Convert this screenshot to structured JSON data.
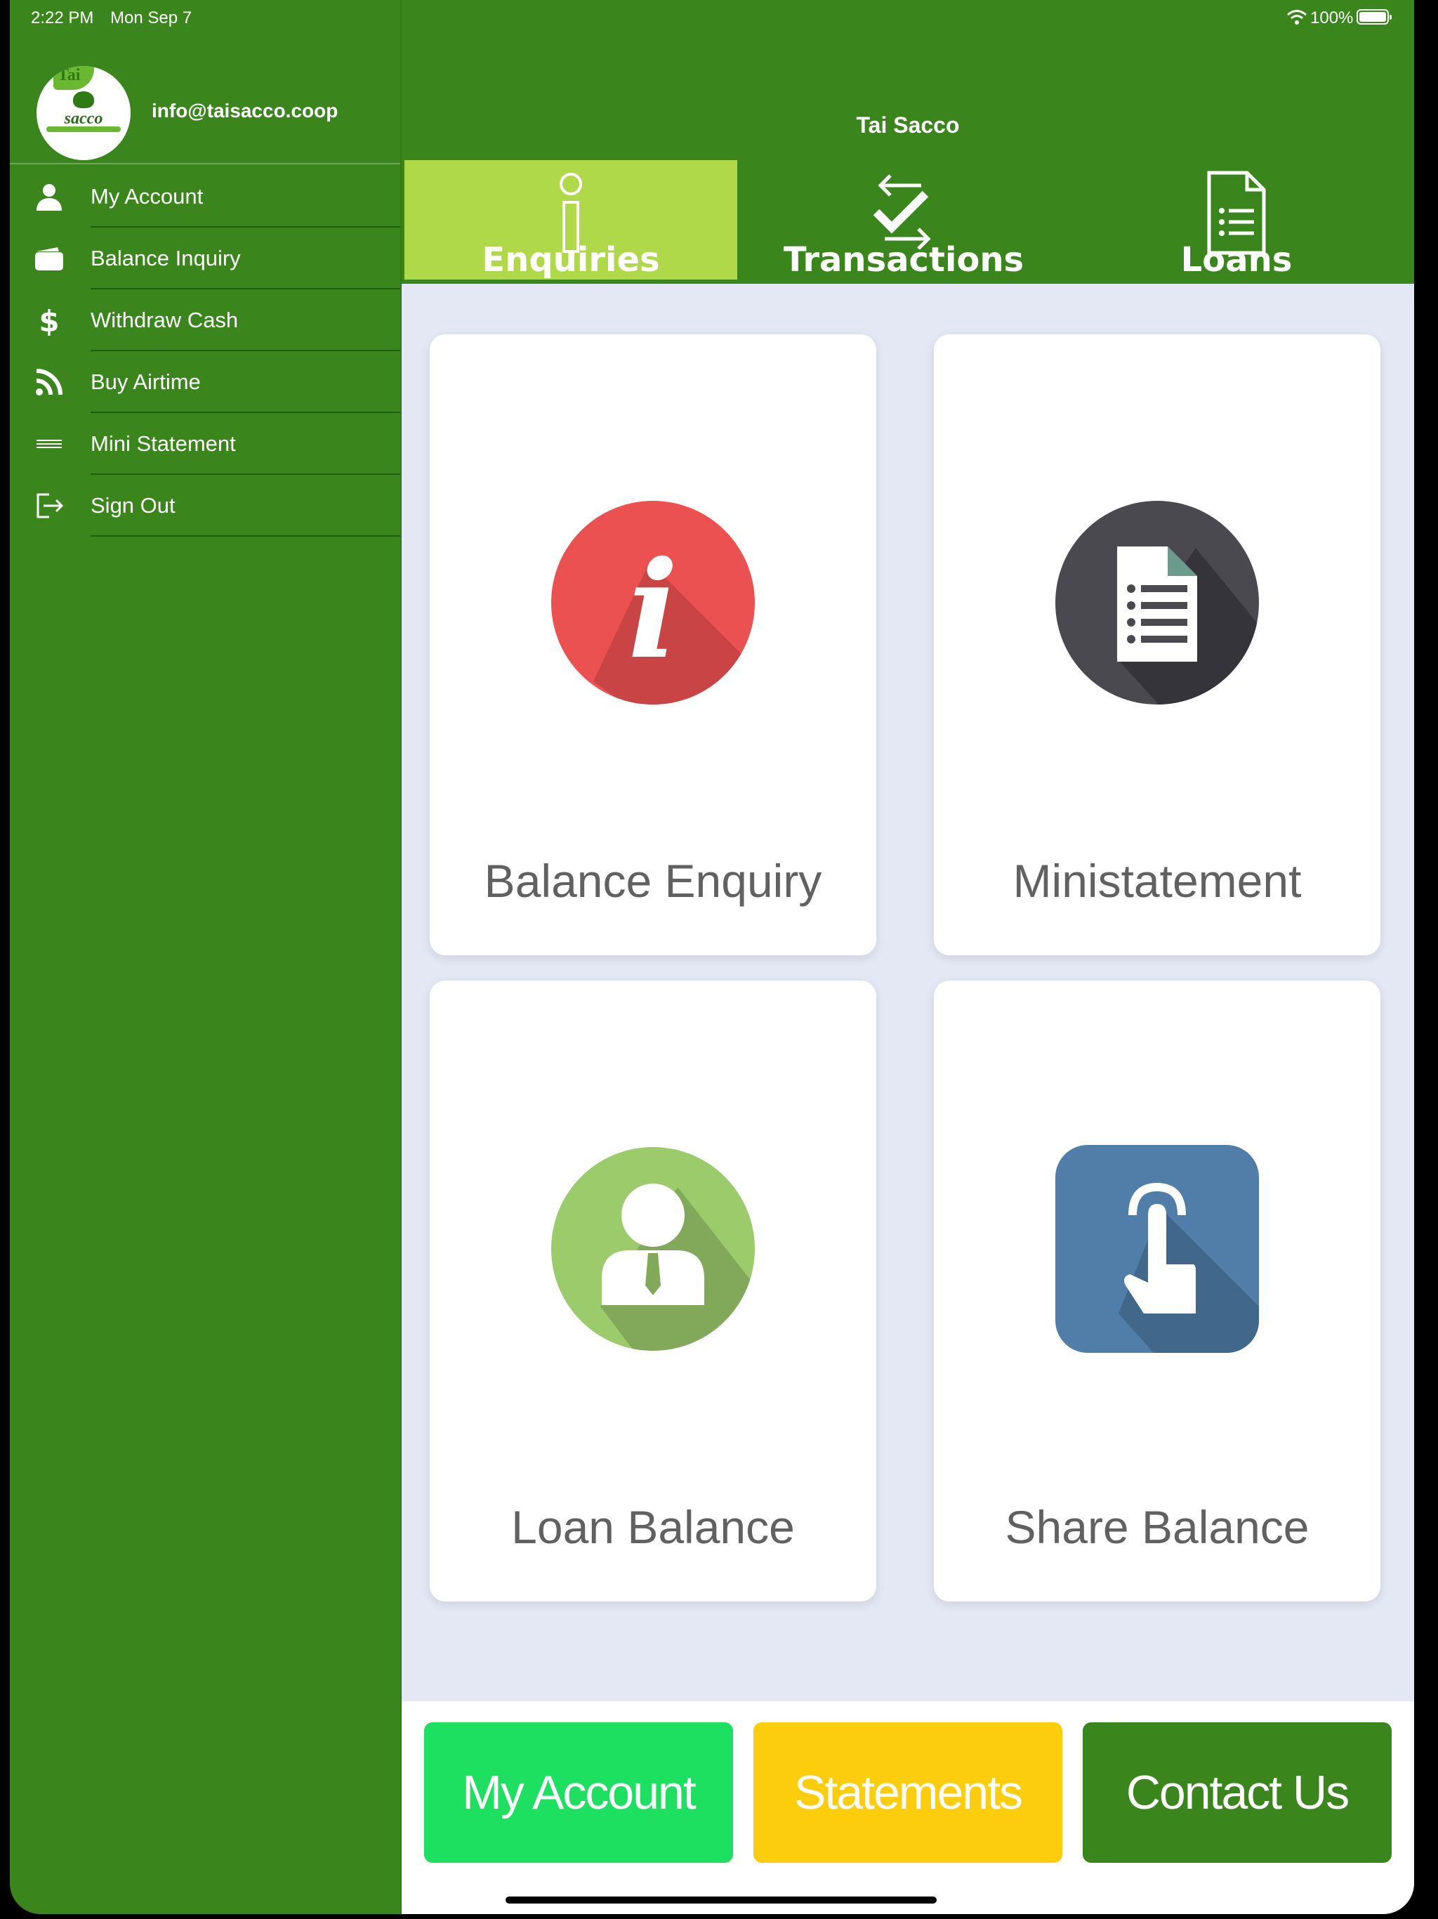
{
  "status_bar": {
    "time": "2:22 PM",
    "date": "Mon Sep 7",
    "battery": "100%"
  },
  "sidebar": {
    "logo_text": {
      "top": "Tai",
      "main": "sacco"
    },
    "email": "info@taisacco.coop",
    "items": [
      {
        "label": "My Account",
        "icon": "person-icon"
      },
      {
        "label": "Balance Inquiry",
        "icon": "wallet-icon"
      },
      {
        "label": "Withdraw Cash",
        "icon": "dollar-icon"
      },
      {
        "label": "Buy Airtime",
        "icon": "rss-icon"
      },
      {
        "label": "Mini Statement",
        "icon": "lines-icon"
      },
      {
        "label": "Sign Out",
        "icon": "sign-out-icon"
      }
    ]
  },
  "header": {
    "title": "Tai Sacco"
  },
  "tabs": [
    {
      "label": "Enquiries",
      "icon": "info-icon",
      "active": true
    },
    {
      "label": "Transactions",
      "icon": "transfer-icon",
      "active": false
    },
    {
      "label": "Loans",
      "icon": "document-list-icon",
      "active": false
    }
  ],
  "cards": [
    {
      "label": "Balance Enquiry",
      "icon": "info-circle-icon",
      "color": "#ec5151"
    },
    {
      "label": "Ministatement",
      "icon": "statement-doc-icon",
      "color": "#4a4950"
    },
    {
      "label": "Loan Balance",
      "icon": "user-circle-icon",
      "color": "#9bcb6b"
    },
    {
      "label": "Share Balance",
      "icon": "tap-finger-icon",
      "color": "#517ea8"
    }
  ],
  "bottom_buttons": [
    {
      "label": "My Account",
      "color": "#1de060"
    },
    {
      "label": "Statements",
      "color": "#fccd0c"
    },
    {
      "label": "Contact Us",
      "color": "#3a861c"
    }
  ],
  "colors": {
    "brand_green": "#3a861c",
    "tab_active": "#b0d94a",
    "content_bg": "#e4e8f4"
  }
}
